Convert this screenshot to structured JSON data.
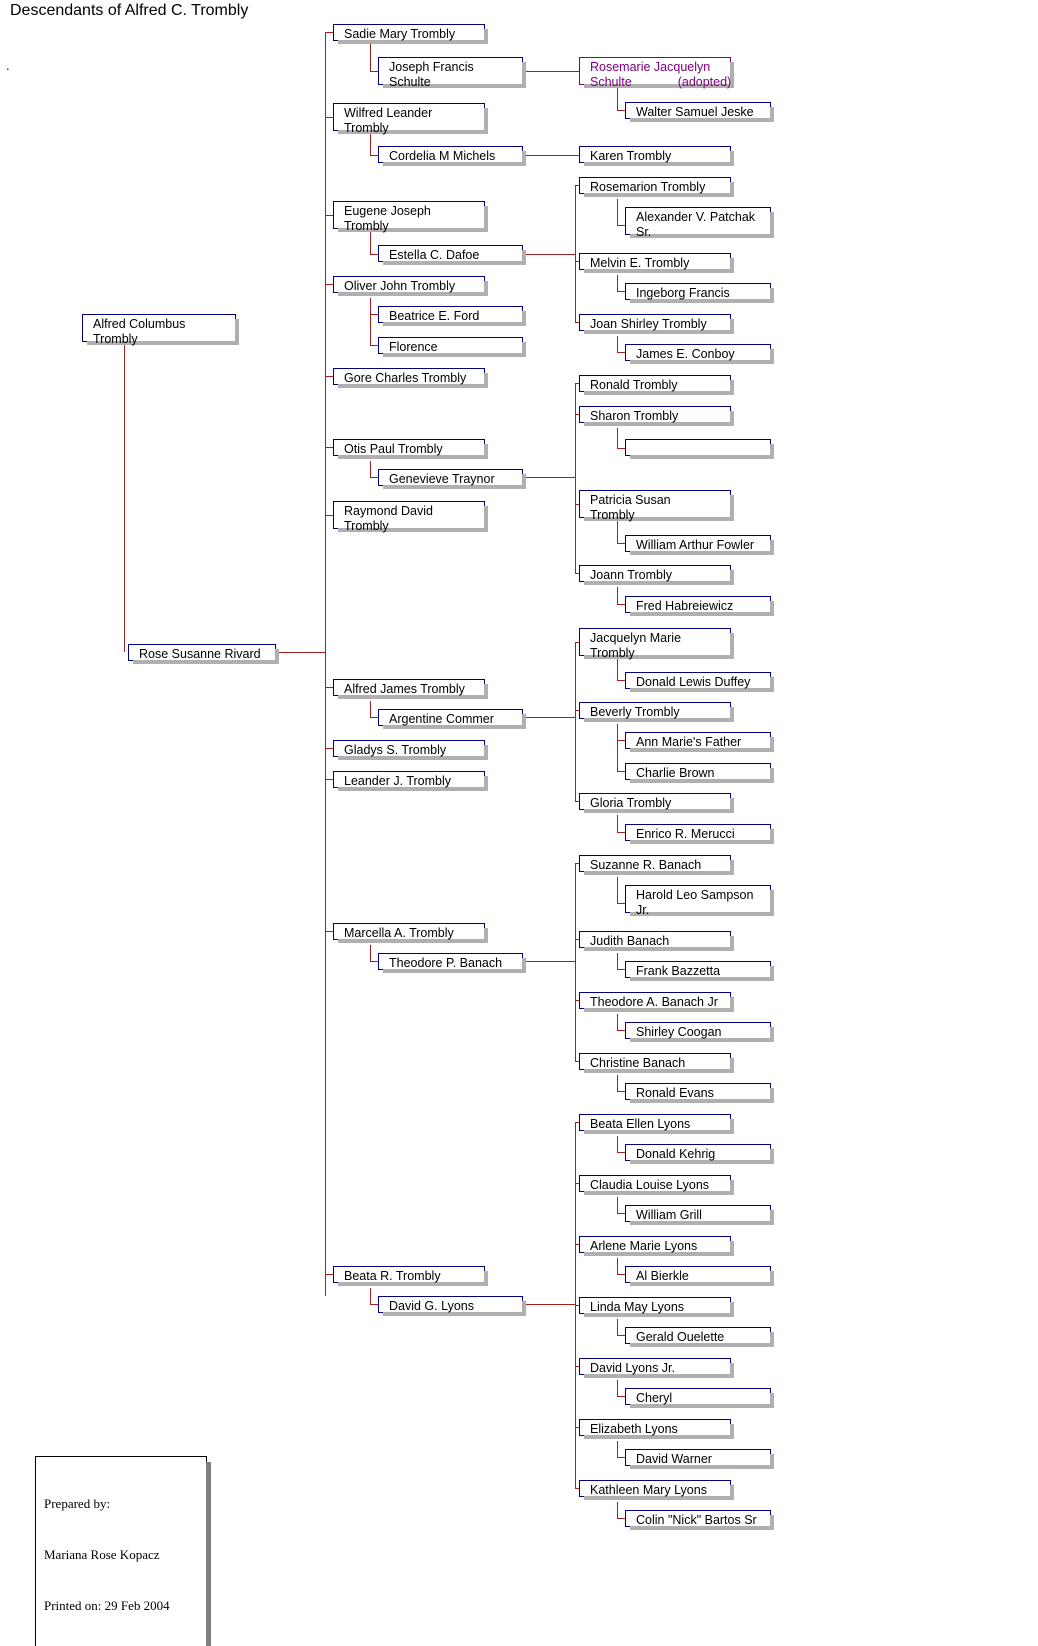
{
  "title": "Descendants of Alfred C. Trombly",
  "marker_dot": ".",
  "colors": {
    "box_border": "#000080",
    "box_border_adopted": "#800080",
    "text": "#000000",
    "text_adopted": "#800080",
    "connector_line": "#A02020",
    "shadow": "#b0b0b0",
    "background": "#ffffff"
  },
  "footer": {
    "prepared_by_label": "Prepared by:",
    "prepared_by_name": "Mariana Rose Kopacz",
    "printed_on": "Printed on: 29 Feb 2004"
  },
  "root": {
    "person": "Alfred Columbus Trombly",
    "spouse": "Rose Susanne Rivard"
  },
  "nodes": {
    "alfred_columbus_trombly": "Alfred Columbus\nTrombly",
    "rose_susanne_rivard": "Rose Susanne Rivard",
    "sadie_mary_trombly": "Sadie Mary Trombly",
    "joseph_francis_schulte": "Joseph Francis\nSchulte",
    "rosemarie_jacquelyn_schulte": "Rosemarie Jacquelyn\nSchulte",
    "rosemarie_adopted_tag": "(adopted)",
    "walter_samuel_jeske": "Walter Samuel Jeske",
    "wilfred_leander_trombly": "Wilfred Leander\nTrombly",
    "cordelia_m_michels": "Cordelia M Michels",
    "karen_trombly": "Karen Trombly",
    "eugene_joseph_trombly": "Eugene Joseph\nTrombly",
    "estella_c_dafoe": "Estella C. Dafoe",
    "rosemarion_trombly": "Rosemarion Trombly",
    "alexander_v_patchak_sr": "Alexander V. Patchak\nSr.",
    "melvin_e_trombly": "Melvin E. Trombly",
    "ingeborg_francis": "Ingeborg Francis",
    "joan_shirley_trombly": "Joan Shirley Trombly",
    "james_e_conboy": "James E. Conboy",
    "oliver_john_trombly": "Oliver John Trombly",
    "beatrice_e_ford": "Beatrice E. Ford",
    "florence": "Florence",
    "gore_charles_trombly": "Gore Charles Trombly",
    "otis_paul_trombly": "Otis Paul Trombly",
    "genevieve_traynor": "Genevieve Traynor",
    "ronald_trombly": "Ronald Trombly",
    "sharon_trombly": "Sharon Trombly",
    "sharon_spouse_unnamed": "",
    "patricia_susan_trombly": "Patricia Susan\nTrombly",
    "william_arthur_fowler": "William Arthur Fowler",
    "joann_trombly": "Joann Trombly",
    "fred_habreiewicz": "Fred Habreiewicz",
    "raymond_david_trombly": "Raymond David\nTrombly",
    "alfred_james_trombly": "Alfred James Trombly",
    "argentine_commer": "Argentine Commer",
    "jacquelyn_marie_trombly": "Jacquelyn Marie\nTrombly",
    "donald_lewis_duffey": "Donald Lewis Duffey",
    "beverly_trombly": "Beverly Trombly",
    "ann_maries_father": "Ann Marie's Father",
    "charlie_brown": "Charlie Brown",
    "gloria_trombly": "Gloria Trombly",
    "enrico_r_merucci": "Enrico R. Merucci",
    "gladys_s_trombly": "Gladys S. Trombly",
    "leander_j_trombly": "Leander J. Trombly",
    "marcella_a_trombly": "Marcella A. Trombly",
    "theodore_p_banach": "Theodore P. Banach",
    "suzanne_r_banach": "Suzanne R. Banach",
    "harold_leo_sampson_jr": "Harold Leo Sampson\nJr.",
    "judith_banach": "Judith Banach",
    "frank_bazzetta": "Frank Bazzetta",
    "theodore_a_banach_jr": "Theodore A. Banach Jr",
    "shirley_coogan": "Shirley Coogan",
    "christine_banach": "Christine Banach",
    "ronald_evans": "Ronald Evans",
    "beata_r_trombly": "Beata R. Trombly",
    "david_g_lyons": "David G. Lyons",
    "beata_ellen_lyons": "Beata Ellen Lyons",
    "donald_kehrig": "Donald Kehrig",
    "claudia_louise_lyons": "Claudia Louise Lyons",
    "william_grill": "William Grill",
    "arlene_marie_lyons": "Arlene Marie Lyons",
    "al_bierkle": "Al Bierkle",
    "linda_may_lyons": "Linda May Lyons",
    "gerald_ouelette": "Gerald Ouelette",
    "david_lyons_jr": "David Lyons Jr.",
    "cheryl": "Cheryl",
    "elizabeth_lyons": "Elizabeth Lyons",
    "david_warner": "David Warner",
    "kathleen_mary_lyons": "Kathleen Mary Lyons",
    "colin_nick_bartos_sr": "Colin \"Nick\" Bartos Sr"
  },
  "generations": {
    "gen1_couple": [
      "Alfred Columbus Trombly",
      "Rose Susanne Rivard"
    ],
    "gen2_children": [
      "Sadie Mary Trombly",
      "Wilfred Leander Trombly",
      "Eugene Joseph Trombly",
      "Oliver John Trombly",
      "Gore Charles Trombly",
      "Otis Paul Trombly",
      "Raymond David Trombly",
      "Alfred James Trombly",
      "Gladys S. Trombly",
      "Leander J. Trombly",
      "Marcella A. Trombly",
      "Beata R. Trombly"
    ],
    "gen3_groups": [
      {
        "parents": [
          "Sadie Mary Trombly",
          "Joseph Francis Schulte"
        ],
        "children": [
          "Rosemarie Jacquelyn Schulte (adopted)"
        ]
      },
      {
        "parents": [
          "Wilfred Leander Trombly",
          "Cordelia M Michels"
        ],
        "children": [
          "Karen Trombly"
        ]
      },
      {
        "parents": [
          "Eugene Joseph Trombly",
          "Estella C. Dafoe"
        ],
        "children": [
          "Rosemarion Trombly",
          "Melvin E. Trombly",
          "Joan Shirley Trombly"
        ]
      },
      {
        "parents": [
          "Otis Paul Trombly",
          "Genevieve Traynor"
        ],
        "children": [
          "Ronald Trombly",
          "Sharon Trombly",
          "Patricia Susan Trombly",
          "Joann Trombly"
        ]
      },
      {
        "parents": [
          "Alfred James Trombly",
          "Argentine Commer"
        ],
        "children": [
          "Jacquelyn Marie Trombly",
          "Beverly Trombly",
          "Gloria Trombly"
        ]
      },
      {
        "parents": [
          "Marcella A. Trombly",
          "Theodore P. Banach"
        ],
        "children": [
          "Suzanne R. Banach",
          "Judith Banach",
          "Theodore A. Banach Jr",
          "Christine Banach"
        ]
      },
      {
        "parents": [
          "Beata R. Trombly",
          "David G. Lyons"
        ],
        "children": [
          "Beata Ellen Lyons",
          "Claudia Louise Lyons",
          "Arlene Marie Lyons",
          "Linda May Lyons",
          "David Lyons Jr.",
          "Elizabeth Lyons",
          "Kathleen Mary Lyons"
        ]
      }
    ]
  }
}
